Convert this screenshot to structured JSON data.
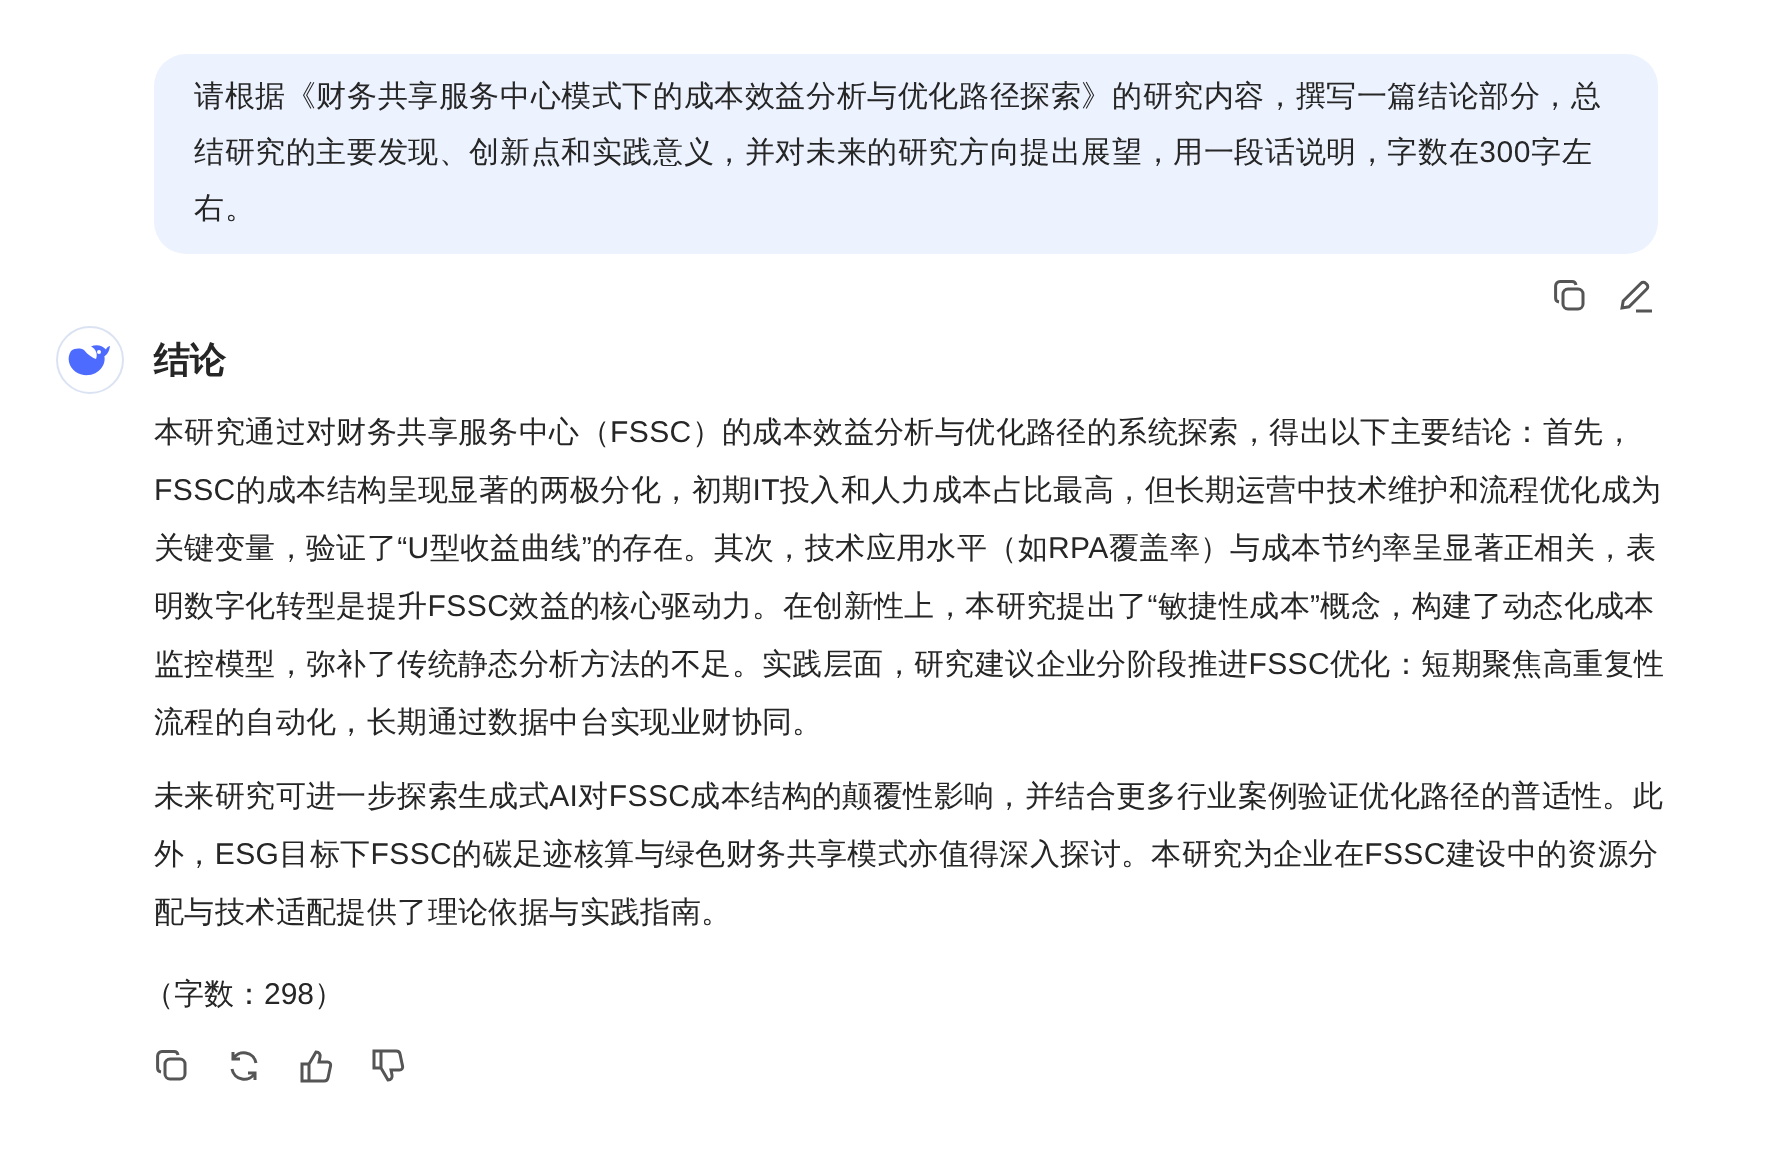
{
  "user_message": {
    "text": "请根据《财务共享服务中心模式下的成本效益分析与优化路径探索》的研究内容，撰写一篇结论部分，总结研究的主要发现、创新点和实践意义，并对未来的研究方向提出展望，用一段话说明，字数在300字左右。"
  },
  "assistant_message": {
    "title": "结论",
    "paragraphs": [
      "本研究通过对财务共享服务中心（FSSC）的成本效益分析与优化路径的系统探索，得出以下主要结论：首先，FSSC的成本结构呈现显著的两极分化，初期IT投入和人力成本占比最高，但长期运营中技术维护和流程优化成为关键变量，验证了“U型收益曲线”的存在。其次，技术应用水平（如RPA覆盖率）与成本节约率呈显著正相关，表明数字化转型是提升FSSC效益的核心驱动力。在创新性上，本研究提出了“敏捷性成本”概念，构建了动态化成本监控模型，弥补了传统静态分析方法的不足。实践层面，研究建议企业分阶段推进FSSC优化：短期聚焦高重复性流程的自动化，长期通过数据中台实现业财协同。",
      "未来研究可进一步探索生成式AI对FSSC成本结构的颠覆性影响，并结合更多行业案例验证优化路径的普适性。此外，ESG目标下FSSC的碳足迹核算与绿色财务共享模式亦值得深入探讨。本研究为企业在FSSC建设中的资源分配与技术适配提供了理论依据与实践指南。"
    ],
    "word_count": "（字数：298）"
  }
}
